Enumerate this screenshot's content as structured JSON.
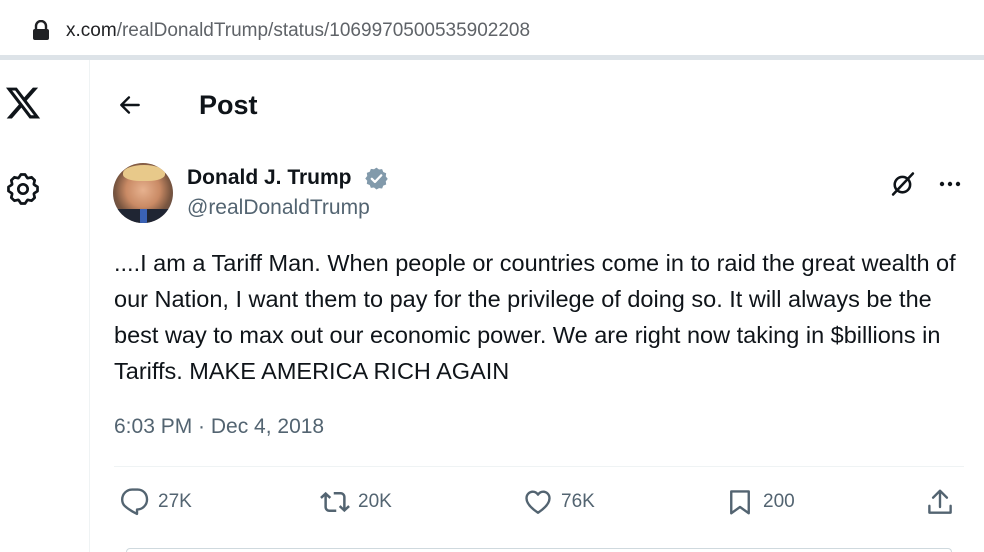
{
  "browser": {
    "url_host": "x.com",
    "url_path": "/realDonaldTrump/status/1069970500535902208"
  },
  "header": {
    "title": "Post"
  },
  "tweet": {
    "author": {
      "display_name": "Donald J. Trump",
      "handle": "@realDonaldTrump"
    },
    "text": "....I am a Tariff Man. When people or countries come in to raid the great wealth of our Nation, I want them to pay for the privilege of doing so. It will always be the best way to max out our economic power. We are right now taking in $billions in Tariffs. MAKE AMERICA RICH AGAIN",
    "timestamp": "6:03 PM · Dec 4, 2018"
  },
  "actions": {
    "replies": "27K",
    "reposts": "20K",
    "likes": "76K",
    "bookmarks": "200"
  },
  "colors": {
    "text": "#0f1419",
    "secondary": "#536471",
    "verified": "#829aab"
  }
}
